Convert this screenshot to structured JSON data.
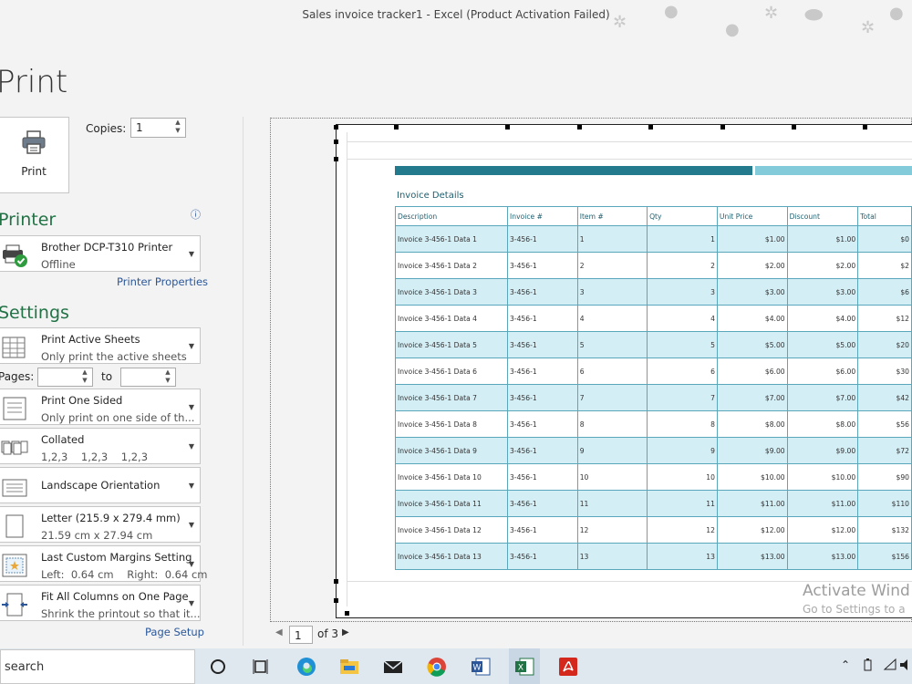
{
  "window": {
    "title": "Sales invoice tracker1 - Excel (Product Activation Failed)"
  },
  "backstage": {
    "heading": "Print",
    "print_button": {
      "label": "Print",
      "icon": "printer-icon"
    },
    "copies": {
      "label": "Copies:",
      "value": "1"
    },
    "printer_section": "Printer",
    "printer": {
      "name": "Brother DCP-T310 Printer",
      "status": "Offline",
      "properties_link": "Printer Properties"
    },
    "settings_section": "Settings",
    "settings": {
      "scope": {
        "title": "Print Active Sheets",
        "subtitle": "Only print the active sheets"
      },
      "pages": {
        "label": "Pages:",
        "to_label": "to",
        "from": "",
        "to": ""
      },
      "sides": {
        "title": "Print One Sided",
        "subtitle": "Only print on one side of th..."
      },
      "collation": {
        "title": "Collated",
        "subtitle": "1,2,3    1,2,3    1,2,3"
      },
      "orientation": {
        "title": "Landscape Orientation"
      },
      "paper": {
        "title": "Letter (215.9 x 279.4 mm)",
        "subtitle": "21.59 cm x 27.94 cm"
      },
      "margins": {
        "title": "Last Custom Margins Setting",
        "subtitle": "Left:  0.64 cm    Right:  0.64 cm"
      },
      "scaling": {
        "title": "Fit All Columns on One Page",
        "subtitle": "Shrink the printout so that it..."
      }
    },
    "page_setup_link": "Page Setup"
  },
  "preview": {
    "invoice_title": "Invoice Details",
    "columns": [
      "Description",
      "Invoice #",
      "Item #",
      "Qty",
      "Unit Price",
      "Discount",
      "Total"
    ],
    "rows": [
      [
        "Invoice 3-456-1 Data 1",
        "3-456-1",
        "1",
        "1",
        "$1.00",
        "$1.00",
        "$0"
      ],
      [
        "Invoice 3-456-1 Data 2",
        "3-456-1",
        "2",
        "2",
        "$2.00",
        "$2.00",
        "$2"
      ],
      [
        "Invoice 3-456-1 Data 3",
        "3-456-1",
        "3",
        "3",
        "$3.00",
        "$3.00",
        "$6"
      ],
      [
        "Invoice 3-456-1 Data 4",
        "3-456-1",
        "4",
        "4",
        "$4.00",
        "$4.00",
        "$12"
      ],
      [
        "Invoice 3-456-1 Data 5",
        "3-456-1",
        "5",
        "5",
        "$5.00",
        "$5.00",
        "$20"
      ],
      [
        "Invoice 3-456-1 Data 6",
        "3-456-1",
        "6",
        "6",
        "$6.00",
        "$6.00",
        "$30"
      ],
      [
        "Invoice 3-456-1 Data 7",
        "3-456-1",
        "7",
        "7",
        "$7.00",
        "$7.00",
        "$42"
      ],
      [
        "Invoice 3-456-1 Data 8",
        "3-456-1",
        "8",
        "8",
        "$8.00",
        "$8.00",
        "$56"
      ],
      [
        "Invoice 3-456-1 Data 9",
        "3-456-1",
        "9",
        "9",
        "$9.00",
        "$9.00",
        "$72"
      ],
      [
        "Invoice 3-456-1 Data 10",
        "3-456-1",
        "10",
        "10",
        "$10.00",
        "$10.00",
        "$90"
      ],
      [
        "Invoice 3-456-1 Data 11",
        "3-456-1",
        "11",
        "11",
        "$11.00",
        "$11.00",
        "$110"
      ],
      [
        "Invoice 3-456-1 Data 12",
        "3-456-1",
        "12",
        "12",
        "$12.00",
        "$12.00",
        "$132"
      ],
      [
        "Invoice 3-456-1 Data 13",
        "3-456-1",
        "13",
        "13",
        "$13.00",
        "$13.00",
        "$156"
      ]
    ],
    "watermark": {
      "line1": "Activate Wind",
      "line2": "Go to Settings to a"
    },
    "pager": {
      "current": "1",
      "of_label": "of 3"
    }
  },
  "taskbar": {
    "search_text": "search",
    "apps": [
      "cortana-icon",
      "task-view-icon",
      "edge-icon",
      "file-explorer-icon",
      "mail-icon",
      "chrome-icon",
      "word-icon",
      "excel-icon",
      "acrobat-icon"
    ]
  },
  "colors": {
    "accent_green": "#217346",
    "table_header_bar": "#237a8c",
    "table_stripe": "#d4eef5"
  }
}
